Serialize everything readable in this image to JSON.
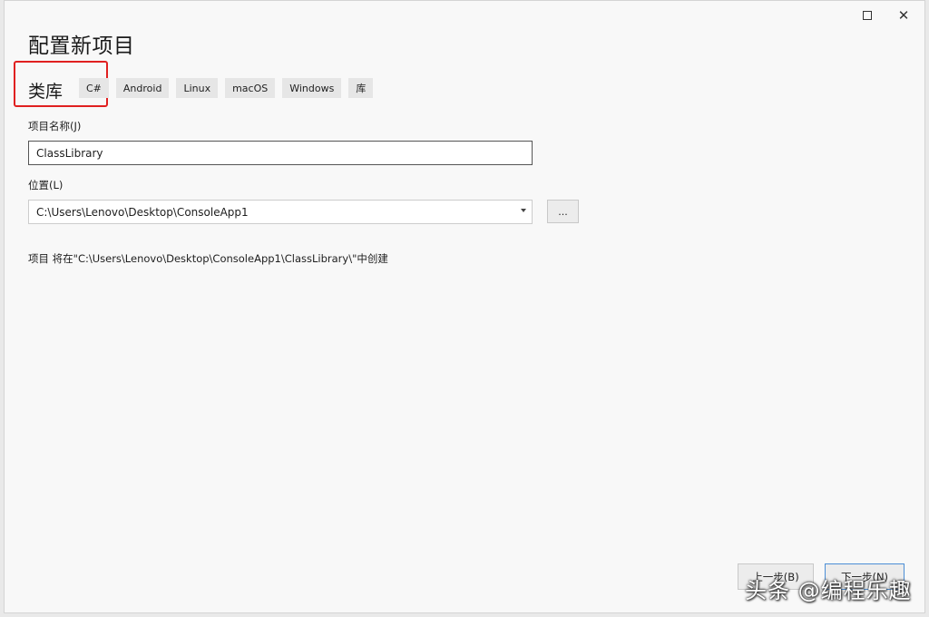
{
  "window": {
    "title": "配置新项目"
  },
  "template": {
    "name": "类库",
    "tags": [
      "C#",
      "Android",
      "Linux",
      "macOS",
      "Windows",
      "库"
    ]
  },
  "project_name": {
    "label": "项目名称(J)",
    "value": "ClassLibrary"
  },
  "location": {
    "label": "位置(L)",
    "value": "C:\\Users\\Lenovo\\Desktop\\ConsoleApp1",
    "browse_label": "..."
  },
  "info": {
    "text": "项目 将在\"C:\\Users\\Lenovo\\Desktop\\ConsoleApp1\\ClassLibrary\\\"中创建"
  },
  "footer": {
    "back_label": "上一步(B)",
    "next_label": "下一步(N)"
  },
  "watermark": {
    "text": "头条 @编程乐趣"
  },
  "colors": {
    "highlight": "#e02020",
    "primary_border": "#4c8ed6"
  }
}
